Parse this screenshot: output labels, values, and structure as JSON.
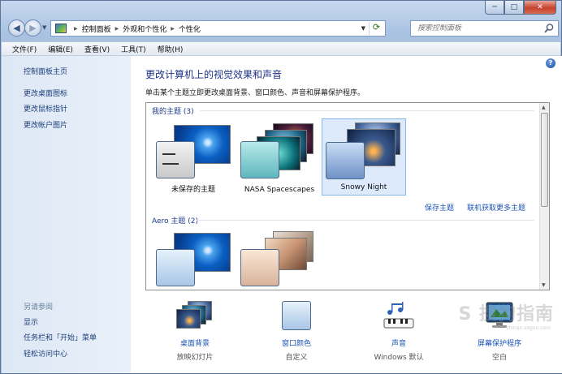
{
  "window": {
    "caption": {
      "minimize": "─",
      "maximize": "□",
      "close": "✕"
    }
  },
  "address": {
    "breadcrumbs": [
      "控制面板",
      "外观和个性化",
      "个性化"
    ],
    "search_placeholder": "搜索控制面板"
  },
  "menu": [
    "文件(F)",
    "编辑(E)",
    "查看(V)",
    "工具(T)",
    "帮助(H)"
  ],
  "sidebar": {
    "links": [
      "控制面板主页",
      "更改桌面图标",
      "更改鼠标指针",
      "更改帐户图片"
    ],
    "see_also_label": "另请参阅",
    "see_also_links": [
      "显示",
      "任务栏和「开始」菜单",
      "轻松访问中心"
    ]
  },
  "main": {
    "title": "更改计算机上的视觉效果和声音",
    "subtitle": "单击某个主题立即更改桌面背景、窗口颜色、声音和屏幕保护程序。",
    "my_themes_label": "我的主题 (3)",
    "my_themes": [
      {
        "name": "未保存的主题",
        "selected": false
      },
      {
        "name": "NASA Spacescapes",
        "selected": false
      },
      {
        "name": "Snowy Night",
        "selected": true
      }
    ],
    "save_theme": "保存主题",
    "more_themes": "联机获取更多主题",
    "aero_label": "Aero 主题 (2)"
  },
  "customize": [
    {
      "label": "桌面背景",
      "sub": "放映幻灯片",
      "icon": "desktop-background-icon"
    },
    {
      "label": "窗口颜色",
      "sub": "自定义",
      "icon": "window-color-icon"
    },
    {
      "label": "声音",
      "sub": "Windows 默认",
      "icon": "sounds-icon"
    },
    {
      "label": "屏幕保护程序",
      "sub": "空白",
      "icon": "screensaver-icon"
    }
  ],
  "watermark": {
    "text": "S 搜狗指南",
    "sub": "zhinan.sogou.com"
  }
}
